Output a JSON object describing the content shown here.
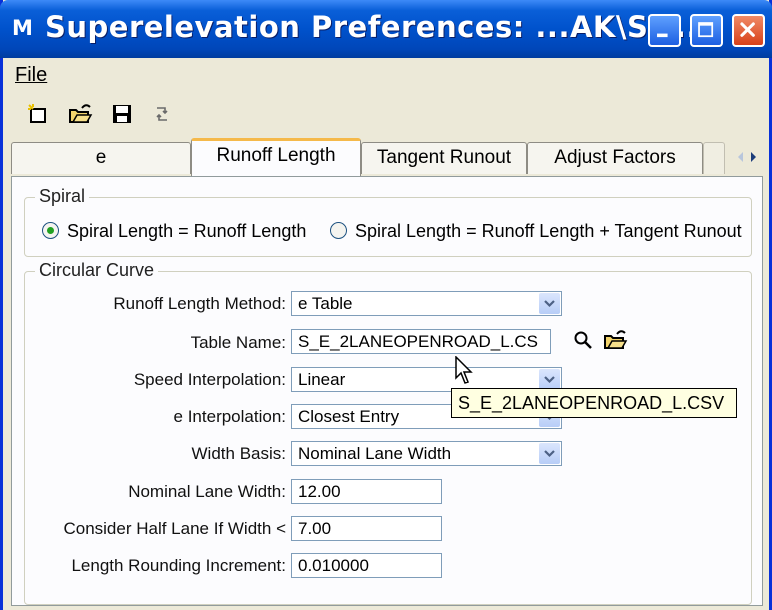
{
  "window": {
    "title": "Superelevation Preferences: ...AK\\S_...",
    "app_icon": "M",
    "controls": {
      "minimize": "minimize-icon",
      "maximize": "maximize-icon",
      "close": "close-icon"
    }
  },
  "menu": {
    "file_label": "File"
  },
  "toolbar": {
    "icons": [
      "new-file-icon",
      "open-folder-icon",
      "save-icon",
      "refresh-icon"
    ]
  },
  "tabs": [
    {
      "label": "e",
      "active": false
    },
    {
      "label": "Runoff Length",
      "active": true
    },
    {
      "label": "Tangent Runout",
      "active": false
    },
    {
      "label": "Adjust Factors",
      "active": false
    }
  ],
  "spiral": {
    "title": "Spiral",
    "option1": "Spiral Length = Runoff Length",
    "option2": "Spiral Length = Runoff Length + Tangent Runout",
    "selected": 1
  },
  "circular_curve": {
    "title": "Circular Curve",
    "runoff_length_method": {
      "label": "Runoff Length Method:",
      "value": "e Table"
    },
    "table_name": {
      "label": "Table Name:",
      "value": "S_E_2LANEOPENROAD_L.CS"
    },
    "speed_interpolation": {
      "label": "Speed Interpolation:",
      "value": "Linear"
    },
    "e_interpolation": {
      "label": "e Interpolation:",
      "value": "Closest Entry"
    },
    "width_basis": {
      "label": "Width Basis:",
      "value": "Nominal Lane Width"
    },
    "nominal_lane_width": {
      "label": "Nominal Lane Width:",
      "value": "12.00"
    },
    "consider_half_lane": {
      "label": "Consider Half Lane If Width <",
      "value": "7.00"
    },
    "length_rounding": {
      "label": "Length Rounding Increment:",
      "value": "0.010000"
    }
  },
  "tooltip": {
    "text": "S_E_2LANEOPENROAD_L.CSV"
  },
  "colors": {
    "title_bar": "#0052cc",
    "window_bg": "#ece9d8",
    "tab_highlight": "#f5b94a",
    "tooltip_bg": "#ffffe1"
  }
}
